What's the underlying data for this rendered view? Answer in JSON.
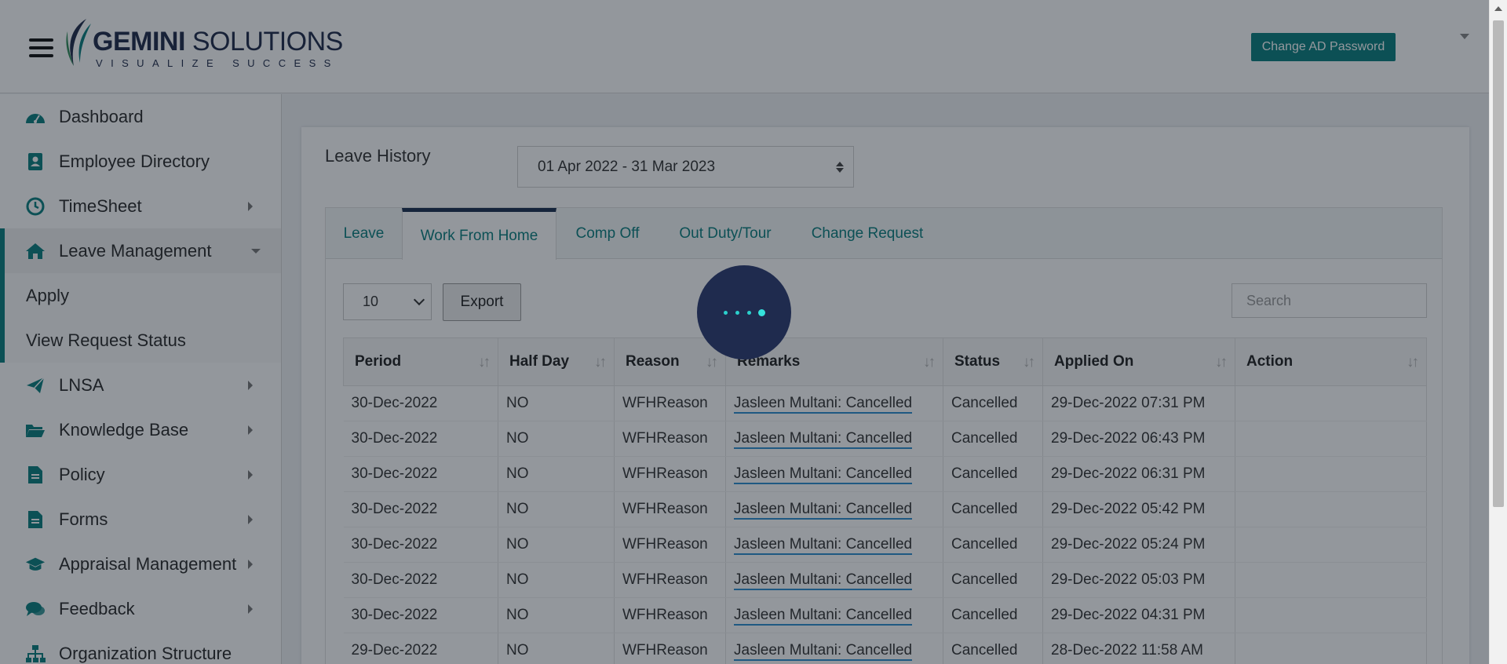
{
  "header": {
    "logo_name_bold": "GEMINI",
    "logo_name_rest": " SOLUTIONS",
    "logo_tagline": "VISUALIZE SUCCESS",
    "change_password_label": "Change AD Password"
  },
  "sidebar": {
    "items": [
      {
        "label": "Dashboard",
        "icon": "dashboard-icon"
      },
      {
        "label": "Employee Directory",
        "icon": "address-book-icon"
      },
      {
        "label": "TimeSheet",
        "icon": "clock-icon"
      },
      {
        "label": "Leave Management",
        "icon": "home-icon"
      },
      {
        "label": "LNSA",
        "icon": "paper-plane-icon"
      },
      {
        "label": "Knowledge Base",
        "icon": "folder-open-icon"
      },
      {
        "label": "Policy",
        "icon": "document-icon"
      },
      {
        "label": "Forms",
        "icon": "document-icon"
      },
      {
        "label": "Appraisal Management",
        "icon": "graduation-cap-icon"
      },
      {
        "label": "Feedback",
        "icon": "comments-icon"
      },
      {
        "label": "Organization Structure",
        "icon": "sitemap-icon"
      }
    ],
    "sub_items": [
      "Apply",
      "View Request Status"
    ]
  },
  "main": {
    "title": "Leave History",
    "year_range": "01 Apr 2022 - 31 Mar 2023",
    "tabs": [
      "Leave",
      "Work From Home",
      "Comp Off",
      "Out Duty/Tour",
      "Change Request"
    ],
    "active_tab": "Work From Home",
    "page_length": "10",
    "export_label": "Export",
    "search_placeholder": "Search",
    "columns": [
      "Period",
      "Half Day",
      "Reason",
      "Remarks",
      "Status",
      "Applied On",
      "Action"
    ],
    "rows": [
      [
        "30-Dec-2022",
        "NO",
        "WFHReason",
        "Jasleen Multani: Cancelled",
        "Cancelled",
        "29-Dec-2022 07:31 PM",
        ""
      ],
      [
        "30-Dec-2022",
        "NO",
        "WFHReason",
        "Jasleen Multani: Cancelled",
        "Cancelled",
        "29-Dec-2022 06:43 PM",
        ""
      ],
      [
        "30-Dec-2022",
        "NO",
        "WFHReason",
        "Jasleen Multani: Cancelled",
        "Cancelled",
        "29-Dec-2022 06:31 PM",
        ""
      ],
      [
        "30-Dec-2022",
        "NO",
        "WFHReason",
        "Jasleen Multani: Cancelled",
        "Cancelled",
        "29-Dec-2022 05:42 PM",
        ""
      ],
      [
        "30-Dec-2022",
        "NO",
        "WFHReason",
        "Jasleen Multani: Cancelled",
        "Cancelled",
        "29-Dec-2022 05:24 PM",
        ""
      ],
      [
        "30-Dec-2022",
        "NO",
        "WFHReason",
        "Jasleen Multani: Cancelled",
        "Cancelled",
        "29-Dec-2022 05:03 PM",
        ""
      ],
      [
        "30-Dec-2022",
        "NO",
        "WFHReason",
        "Jasleen Multani: Cancelled",
        "Cancelled",
        "29-Dec-2022 04:31 PM",
        ""
      ],
      [
        "29-Dec-2022",
        "NO",
        "WFHReason",
        "Jasleen Multani: Cancelled",
        "Cancelled",
        "28-Dec-2022 11:58 AM",
        ""
      ]
    ]
  },
  "colors": {
    "accent": "#0a7f7f",
    "navy": "#1b2f4f",
    "spinner_dot": "#35e2dc",
    "remark_underline": "#2c8fd0"
  }
}
